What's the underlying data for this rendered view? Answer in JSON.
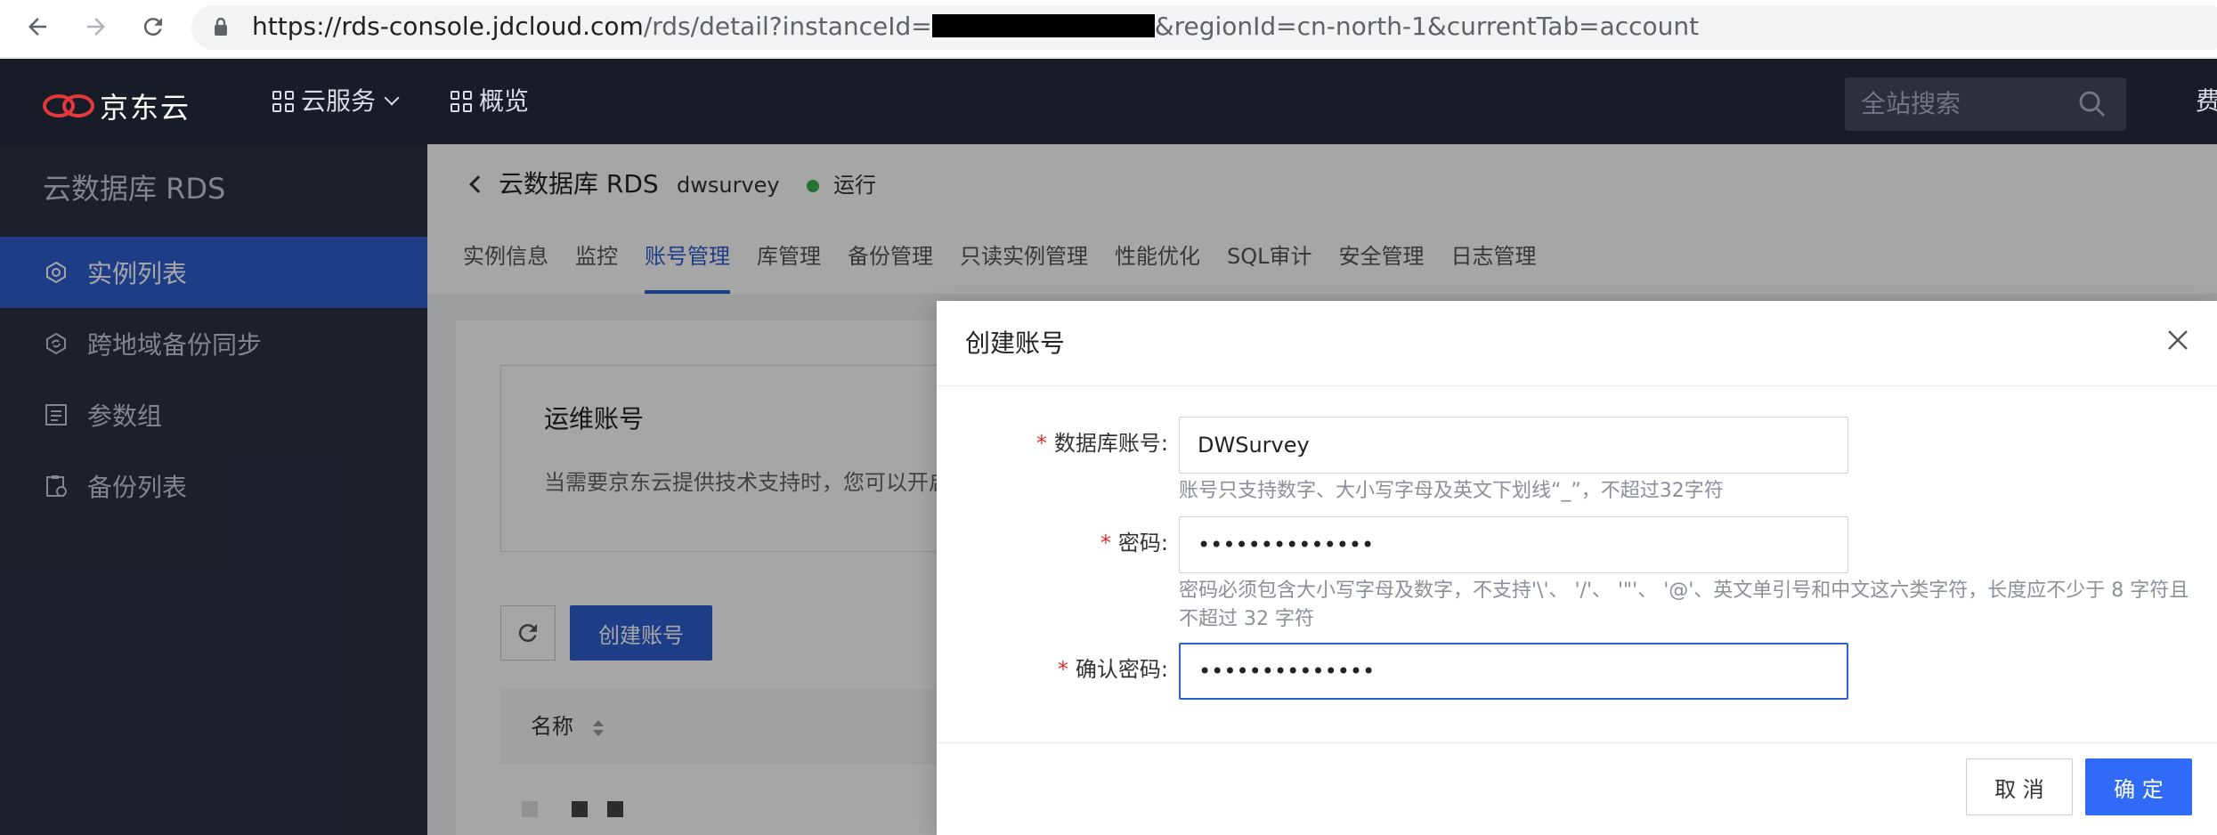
{
  "browser": {
    "url_host": "https://rds-console.jdcloud.com",
    "url_path_before": "/rds/detail?instanceId=",
    "url_path_after": "&regionId=cn-north-1&currentTab=account",
    "icons": [
      "back-arrow-icon",
      "forward-arrow-icon",
      "reload-icon",
      "lock-icon"
    ]
  },
  "header": {
    "logo_text": "京东云",
    "nav": [
      {
        "label": "云服务",
        "icon": "grid-icon",
        "has_dropdown": true
      },
      {
        "label": "概览",
        "icon": "grid-icon",
        "has_dropdown": false
      }
    ],
    "search_placeholder": "全站搜索",
    "right_text": "费"
  },
  "sidebar": {
    "title": "云数据库 RDS",
    "items": [
      {
        "label": "实例列表",
        "icon": "instance-icon",
        "active": true
      },
      {
        "label": "跨地域备份同步",
        "icon": "sync-icon",
        "active": false
      },
      {
        "label": "参数组",
        "icon": "params-icon",
        "active": false
      },
      {
        "label": "备份列表",
        "icon": "backup-icon",
        "active": false
      }
    ]
  },
  "page": {
    "title": "云数据库 RDS",
    "instance_name": "dwsurvey",
    "status": "运行",
    "status_color": "#37b24d",
    "tabs": [
      "实例信息",
      "监控",
      "账号管理",
      "库管理",
      "备份管理",
      "只读实例管理",
      "性能优化",
      "SQL审计",
      "安全管理",
      "日志管理"
    ],
    "active_tab": "账号管理",
    "ops_title": "运维账号",
    "ops_desc": "当需要京东云提供技术支持时，您可以开启",
    "create_account_button": "创建账号",
    "table_header_name": "名称"
  },
  "modal": {
    "title": "创建账号",
    "fields": [
      {
        "label": "数据库账号:",
        "required": true,
        "value": "DWSurvey",
        "hint": "账号只支持数字、大小写字母及英文下划线“_”，不超过32字符"
      },
      {
        "label": "密码:",
        "required": true,
        "value": "••••••••••••••",
        "hint": "密码必须包含大小写字母及数字，不支持'\\'、 '/'、 '\"'、 '@'、英文单引号和中文这六类字符，长度应不少于 8 字符且不超过 32 字符"
      },
      {
        "label": "确认密码:",
        "required": true,
        "value": "••••••••••••••",
        "hint": ""
      }
    ],
    "cancel_label": "取 消",
    "ok_label": "确 定"
  },
  "colors": {
    "primary": "#2f5ecf",
    "header_bg": "#181c27",
    "sidebar_bg": "#2d3140",
    "required": "#e03131"
  }
}
